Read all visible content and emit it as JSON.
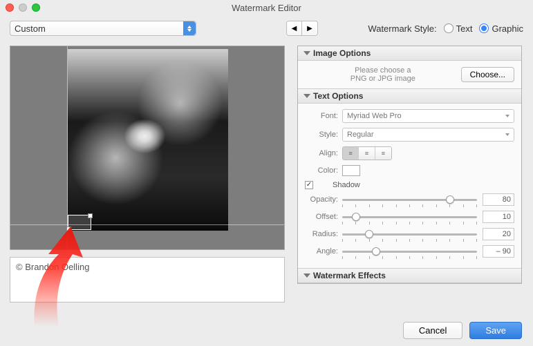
{
  "window": {
    "title": "Watermark Editor"
  },
  "preset": {
    "selected": "Custom"
  },
  "watermark_style": {
    "label": "Watermark Style:",
    "text_label": "Text",
    "graphic_label": "Graphic",
    "selected": "Graphic"
  },
  "sections": {
    "image_options": {
      "title": "Image Options",
      "hint_line1": "Please choose a",
      "hint_line2": "PNG or JPG image",
      "choose_label": "Choose..."
    },
    "text_options": {
      "title": "Text Options",
      "font_label": "Font:",
      "font_value": "Myriad Web Pro",
      "style_label": "Style:",
      "style_value": "Regular",
      "align_label": "Align:",
      "color_label": "Color:",
      "shadow": {
        "label": "Shadow",
        "checked": true,
        "opacity_label": "Opacity:",
        "opacity_value": "80",
        "offset_label": "Offset:",
        "offset_value": "10",
        "radius_label": "Radius:",
        "radius_value": "20",
        "angle_label": "Angle:",
        "angle_value": "– 90"
      }
    },
    "watermark_effects": {
      "title": "Watermark Effects"
    }
  },
  "copyright_text": "© Brandon Oelling",
  "footer": {
    "cancel": "Cancel",
    "save": "Save"
  }
}
